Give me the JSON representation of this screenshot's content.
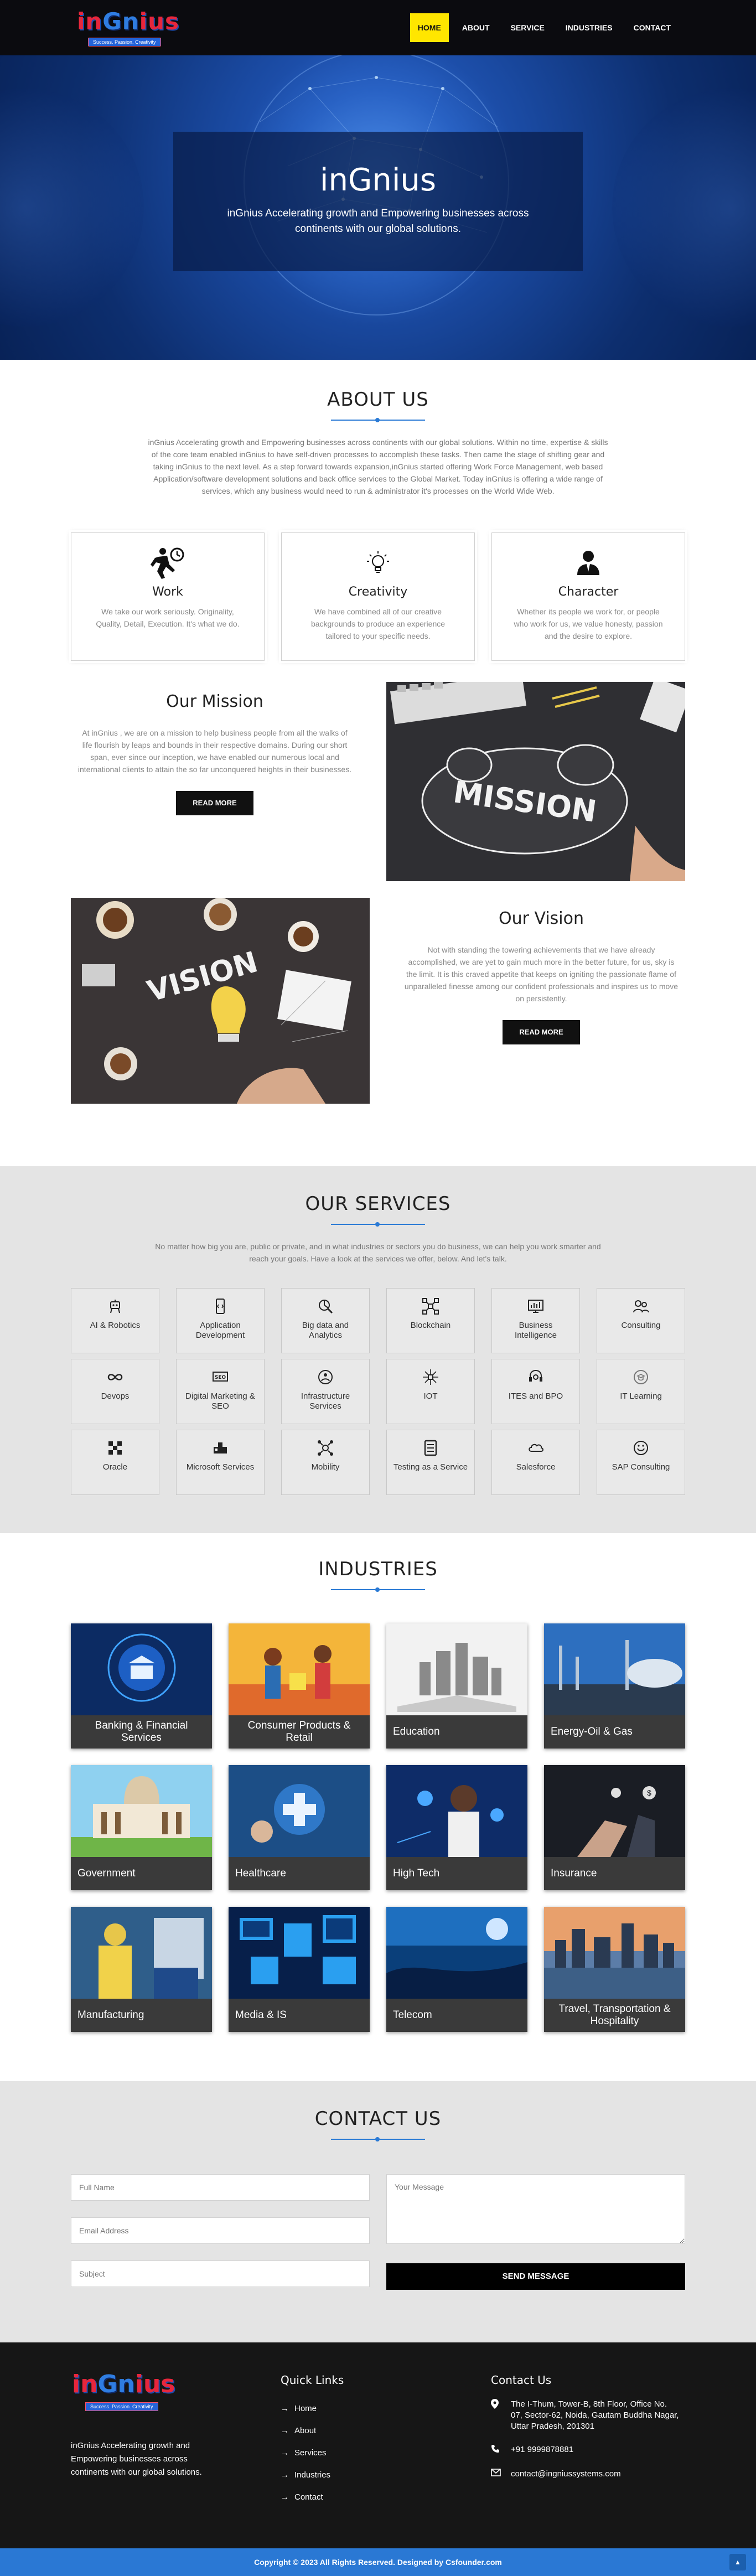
{
  "header": {
    "logo_text_a": "in",
    "logo_text_b": "Gn",
    "logo_text_c": "ius",
    "logo_tagline": "Success. Passion. Creativity",
    "nav": [
      "HOME",
      "ABOUT",
      "SERVICE",
      "INDUSTRIES",
      "CONTACT"
    ],
    "active_nav": "HOME"
  },
  "hero": {
    "title": "inGnius",
    "subtitle": "inGnius Accelerating growth and Empowering businesses across continents with our global solutions."
  },
  "about": {
    "title": "ABOUT US",
    "text": "inGnius Accelerating growth and Empowering businesses across continents with our global solutions. Within no time, expertise & skills of the core team enabled inGnius to have self-driven processes to accomplish these tasks. Then came the stage of shifting gear and taking inGnius to the next level. As a step forward towards expansion,inGnius started offering Work Force Management, web based Application/software development solutions and back office services to the Global Market. Today inGnius is offering a wide range of services, which any business would need to run & administrator it's processes on the World Wide Web.",
    "cards": [
      {
        "icon": "worker-icon",
        "title": "Work",
        "text": "We take our work seriously. Originality, Quality, Detail, Execution. It's what we do."
      },
      {
        "icon": "lightbulb-icon",
        "title": "Creativity",
        "text": "We have combined all of our creative backgrounds to produce an experience tailored to your specific needs."
      },
      {
        "icon": "user-tie-icon",
        "title": "Character",
        "text": "Whether its people we work for, or people who work for us, we value honesty, passion and the desire to explore."
      }
    ]
  },
  "mission": {
    "title": "Our Mission",
    "text": "At inGnius , we are on a mission to help business people from all the walks of life flourish by leaps and bounds in their respective domains. During our short span, ever since our inception, we have enabled our numerous local and international clients to attain the so far unconquered heights in their businesses.",
    "button": "READ MORE",
    "image_word": "MISSION"
  },
  "vision": {
    "title": "Our Vision",
    "text": "Not with standing the towering achievements that we have already accomplished, we are yet to gain much more in the better future, for us, sky is the limit. It is this craved appetite that keeps on igniting the passionate flame of unparalleled finesse among our confident professionals and inspires us to move on persistently.",
    "button": "READ MORE",
    "image_word": "VISION"
  },
  "services": {
    "title": "OUR SERVICES",
    "text": "No matter how big you are, public or private, and in what industries or sectors you do business, we can help you work smarter and reach your goals. Have a look at the services we offer, below. And let's talk.",
    "items": [
      {
        "label": "AI & Robotics",
        "icon": "robot-icon"
      },
      {
        "label": "Application Development",
        "icon": "mobile-code-icon"
      },
      {
        "label": "Big data and Analytics",
        "icon": "analytics-icon"
      },
      {
        "label": "Blockchain",
        "icon": "blockchain-icon"
      },
      {
        "label": "Business Intelligence",
        "icon": "bi-dashboard-icon"
      },
      {
        "label": "Consulting",
        "icon": "consulting-icon"
      },
      {
        "label": "Devops",
        "icon": "infinity-icon"
      },
      {
        "label": "Digital Marketing & SEO",
        "icon": "seo-icon"
      },
      {
        "label": "Infrastructure Services",
        "icon": "infrastructure-icon"
      },
      {
        "label": "IOT",
        "icon": "iot-icon"
      },
      {
        "label": "ITES and BPO",
        "icon": "headset-icon"
      },
      {
        "label": "IT Learning",
        "icon": "learning-icon"
      },
      {
        "label": "Oracle",
        "icon": "oracle-icon"
      },
      {
        "label": "Microsoft Services",
        "icon": "microsoft-icon"
      },
      {
        "label": "Mobility",
        "icon": "mobility-icon"
      },
      {
        "label": "Testing as a Service",
        "icon": "checklist-icon"
      },
      {
        "label": "Salesforce",
        "icon": "cloud-icon"
      },
      {
        "label": "SAP Consulting",
        "icon": "sap-icon"
      }
    ]
  },
  "industries": {
    "title": "INDUSTRIES",
    "items": [
      {
        "label": "Banking & Financial Services",
        "centered": true
      },
      {
        "label": "Consumer Products & Retail",
        "centered": true
      },
      {
        "label": "Education",
        "centered": false
      },
      {
        "label": "Energy-Oil & Gas",
        "centered": false
      },
      {
        "label": "Government",
        "centered": false
      },
      {
        "label": "Healthcare",
        "centered": false
      },
      {
        "label": "High Tech",
        "centered": false
      },
      {
        "label": "Insurance",
        "centered": false
      },
      {
        "label": "Manufacturing",
        "centered": false
      },
      {
        "label": "Media & IS",
        "centered": false
      },
      {
        "label": "Telecom",
        "centered": false
      },
      {
        "label": "Travel, Transportation & Hospitality",
        "centered": true
      }
    ]
  },
  "contact": {
    "title": "CONTACT US",
    "full_name_placeholder": "Full Name",
    "email_placeholder": "Email Address",
    "subject_placeholder": "Subject",
    "message_placeholder": "Your Message",
    "send_button": "SEND MESSAGE"
  },
  "footer": {
    "description": "inGnius Accelerating growth and Empowering businesses across continents with our global solutions.",
    "quick_links_title": "Quick Links",
    "quick_links": [
      "Home",
      "About",
      "Services",
      "Industries",
      "Contact"
    ],
    "contact_title": "Contact Us",
    "address": "The I-Thum, Tower-B, 8th Floor, Office No. 07, Sector-62, Noida, Gautam Buddha Nagar, Uttar Pradesh, 201301",
    "phone": "+91 9999878881",
    "email": "contact@ingniussystems.com",
    "copyright": "Copyright © 2023 All Rights Reserved. Designed by Csfounder.com"
  },
  "colors": {
    "accent": "#2a78d4",
    "nav_active": "#ffe600",
    "header_bg": "#0b0b0f",
    "footer_bg": "#161616"
  }
}
